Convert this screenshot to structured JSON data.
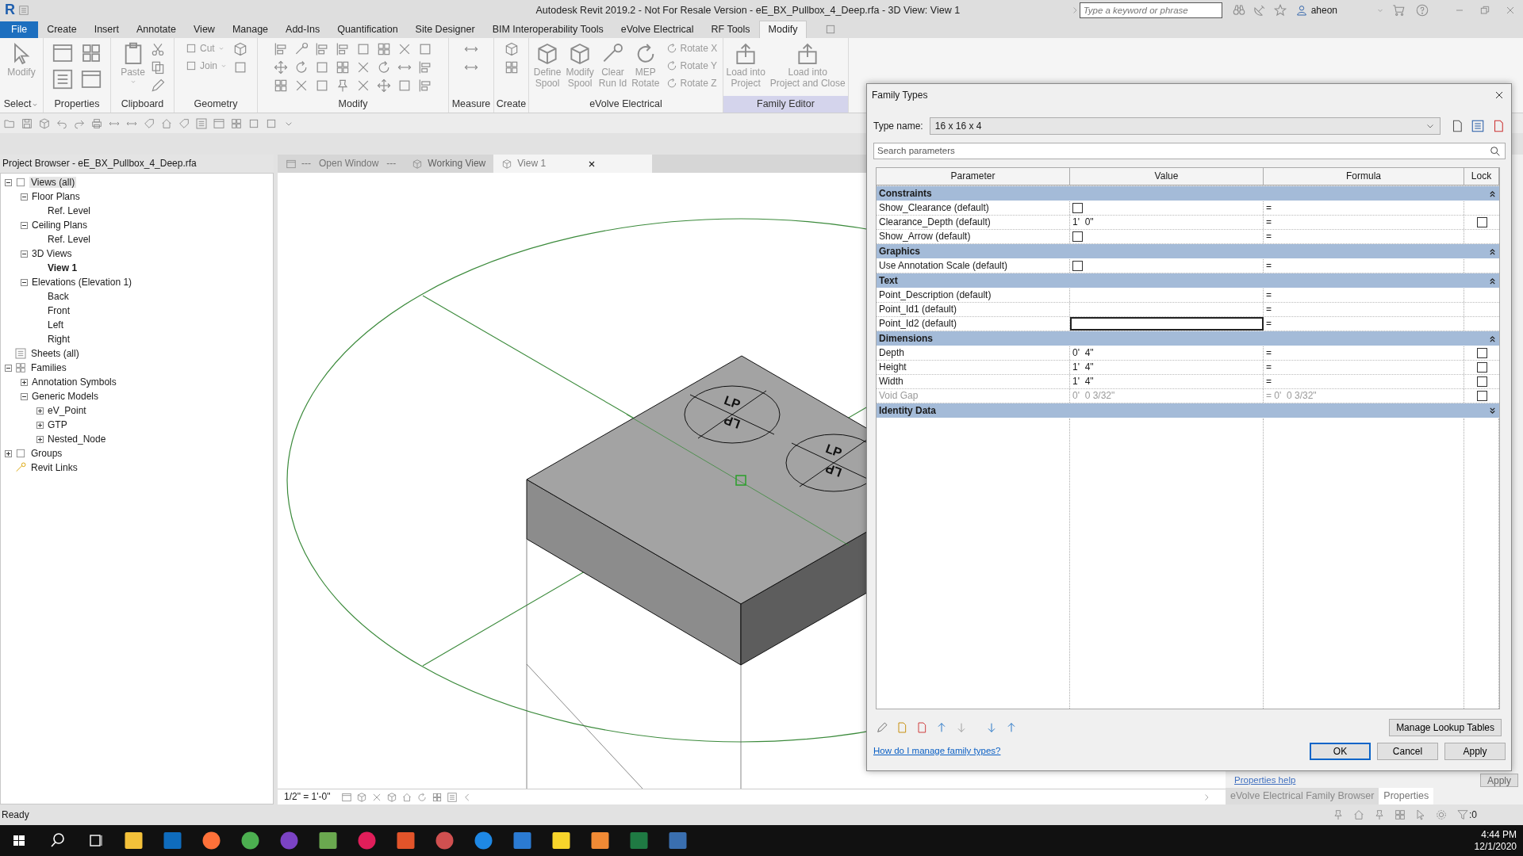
{
  "app": {
    "logo": "R",
    "title": "Autodesk Revit 2019.2 - Not For Resale Version - eE_BX_Pullbox_4_Deep.rfa - 3D View: View 1",
    "search": {
      "placeholder": "Type a keyword or phrase"
    },
    "user": "aheon"
  },
  "file_menu": "File",
  "ribbon_tabs": [
    {
      "label": "Create",
      "selected": false
    },
    {
      "label": "Insert",
      "selected": false
    },
    {
      "label": "Annotate",
      "selected": false
    },
    {
      "label": "View",
      "selected": false
    },
    {
      "label": "Manage",
      "selected": false
    },
    {
      "label": "Add-Ins",
      "selected": false
    },
    {
      "label": "Quantification",
      "selected": false
    },
    {
      "label": "Site Designer",
      "selected": false
    },
    {
      "label": "BIM Interoperability Tools",
      "selected": false
    },
    {
      "label": "eVolve Electrical",
      "selected": false
    },
    {
      "label": "RF Tools",
      "selected": false
    },
    {
      "label": "Modify",
      "selected": true
    }
  ],
  "ribbon_panels": [
    {
      "label": "Select",
      "dropdown": true,
      "contextual": false,
      "tools": [
        {
          "label": "Modify",
          "kind": "large",
          "disabled": true,
          "dropdown": false
        }
      ]
    },
    {
      "label": "Properties",
      "contextual": false
    },
    {
      "label": "Clipboard",
      "contextual": false,
      "tools": [
        {
          "label": "Paste",
          "kind": "large",
          "disabled": true,
          "dropdown": true
        }
      ]
    },
    {
      "label": "Geometry",
      "contextual": false,
      "tools": [
        {
          "label": "Cut",
          "kind": "small",
          "disabled": true,
          "dropdown": true
        },
        {
          "label": "Join",
          "kind": "small",
          "disabled": true,
          "dropdown": true
        }
      ]
    },
    {
      "label": "Modify",
      "contextual": false
    },
    {
      "label": "Measure",
      "contextual": false
    },
    {
      "label": "Create",
      "contextual": false
    },
    {
      "label": "eVolve Electrical",
      "contextual": false,
      "tools": [
        {
          "label": "Define\nSpool",
          "kind": "large",
          "disabled": true,
          "dropdown": false
        },
        {
          "label": "Modify\nSpool",
          "kind": "large",
          "disabled": true,
          "dropdown": false
        },
        {
          "label": "Clear\nRun Id",
          "kind": "large",
          "disabled": true,
          "dropdown": false
        },
        {
          "label": "MEP\nRotate",
          "kind": "large",
          "disabled": true,
          "dropdown": false
        },
        {
          "label": "Rotate X",
          "kind": "small",
          "disabled": true,
          "dropdown": false
        },
        {
          "label": "Rotate Y",
          "kind": "small",
          "disabled": true,
          "dropdown": false
        },
        {
          "label": "Rotate Z",
          "kind": "small",
          "disabled": true,
          "dropdown": false
        }
      ]
    },
    {
      "label": "Family Editor",
      "contextual": true,
      "tools": [
        {
          "label": "Load into\nProject",
          "kind": "large",
          "disabled": true,
          "dropdown": false
        },
        {
          "label": "Load into\nProject and Close",
          "kind": "large",
          "disabled": true,
          "dropdown": false
        }
      ]
    }
  ],
  "project_browser": {
    "title": "Project Browser - eE_BX_Pullbox_4_Deep.rfa",
    "tree": [
      {
        "label": "Views (all)",
        "kind": "views",
        "expanded": true,
        "selected": true,
        "active": false,
        "children": [
          {
            "label": "Floor Plans",
            "expanded": true,
            "selected": false,
            "active": false,
            "children": [
              {
                "label": "Ref. Level",
                "selected": false,
                "active": false
              }
            ]
          },
          {
            "label": "Ceiling Plans",
            "expanded": true,
            "selected": false,
            "active": false,
            "children": [
              {
                "label": "Ref. Level",
                "selected": false,
                "active": false
              }
            ]
          },
          {
            "label": "3D Views",
            "expanded": true,
            "selected": false,
            "active": false,
            "children": [
              {
                "label": "View 1",
                "selected": false,
                "active": true
              }
            ]
          },
          {
            "label": "Elevations (Elevation 1)",
            "expanded": true,
            "selected": false,
            "active": false,
            "children": [
              {
                "label": "Back",
                "selected": false,
                "active": false
              },
              {
                "label": "Front",
                "selected": false,
                "active": false
              },
              {
                "label": "Left",
                "selected": false,
                "active": false
              },
              {
                "label": "Right",
                "selected": false,
                "active": false
              }
            ]
          }
        ]
      },
      {
        "label": "Sheets (all)",
        "kind": "sheets",
        "selected": false,
        "active": false
      },
      {
        "label": "Families",
        "kind": "families",
        "expanded": true,
        "selected": false,
        "active": false,
        "children": [
          {
            "label": "Annotation Symbols",
            "expanded": false,
            "selected": false,
            "active": false
          },
          {
            "label": "Generic Models",
            "expanded": true,
            "selected": false,
            "active": false,
            "children": [
              {
                "label": "eV_Point",
                "expanded": false,
                "selected": false,
                "active": false
              },
              {
                "label": "GTP",
                "expanded": false,
                "selected": false,
                "active": false
              },
              {
                "label": "Nested_Node",
                "expanded": false,
                "selected": false,
                "active": false
              }
            ]
          }
        ]
      },
      {
        "label": "Groups",
        "kind": "groups",
        "expanded": false,
        "selected": false,
        "active": false
      },
      {
        "label": "Revit Links",
        "kind": "links",
        "selected": false,
        "active": false
      }
    ]
  },
  "view_tabs": [
    {
      "label": "---   Open Window   ---",
      "kind": "placeholder",
      "selected": false,
      "closable": false
    },
    {
      "label": "Working View",
      "kind": "view",
      "selected": false,
      "closable": false
    },
    {
      "label": "View 1",
      "kind": "view",
      "selected": true,
      "closable": true
    }
  ],
  "viewport": {
    "annotations": [
      "LP",
      "LP",
      "LP",
      "LP"
    ],
    "scale": "1/2\" = 1'-0\""
  },
  "properties_panel": {
    "help_link": "Properties help",
    "apply": "Apply",
    "tabs": [
      {
        "label": "eVolve Electrical Family Browser",
        "selected": false
      },
      {
        "label": "Properties",
        "selected": true
      }
    ]
  },
  "status_bar": {
    "text": "Ready",
    "filter_count": ":0"
  },
  "taskbar": {
    "time": "4:44 PM",
    "date": "12/1/2020"
  },
  "dialog": {
    "title": "Family Types",
    "type_name_label": "Type name:",
    "type_name": "16 x 16 x 4",
    "search": {
      "placeholder": "Search parameters"
    },
    "columns": [
      "Parameter",
      "Value",
      "Formula",
      "Lock"
    ],
    "groups": [
      {
        "name": "Constraints",
        "expanded": true,
        "params": [
          {
            "name": "Show_Clearance (default)",
            "kind": "checkbox",
            "checked": false,
            "formula": "=",
            "disabled": false,
            "editing": false
          },
          {
            "name": "Clearance_Depth (default)",
            "kind": "text",
            "value": "1'  0\"",
            "formula": "=",
            "lock": false,
            "disabled": false,
            "editing": false
          },
          {
            "name": "Show_Arrow (default)",
            "kind": "checkbox",
            "checked": false,
            "formula": "=",
            "disabled": false,
            "editing": false
          }
        ]
      },
      {
        "name": "Graphics",
        "expanded": true,
        "params": [
          {
            "name": "Use Annotation Scale (default)",
            "kind": "checkbox",
            "checked": false,
            "formula": "=",
            "disabled": false,
            "editing": false
          }
        ]
      },
      {
        "name": "Text",
        "expanded": true,
        "params": [
          {
            "name": "Point_Description (default)",
            "kind": "text",
            "formula": "=",
            "disabled": false,
            "editing": false
          },
          {
            "name": "Point_Id1 (default)",
            "kind": "text",
            "formula": "=",
            "disabled": false,
            "editing": false
          },
          {
            "name": "Point_Id2 (default)",
            "kind": "text",
            "formula": "=",
            "disabled": false,
            "editing": true
          }
        ]
      },
      {
        "name": "Dimensions",
        "expanded": true,
        "params": [
          {
            "name": "Depth",
            "kind": "text",
            "value": "0'  4\"",
            "formula": "=",
            "lock": false,
            "disabled": false,
            "editing": false
          },
          {
            "name": "Height",
            "kind": "text",
            "value": "1'  4\"",
            "formula": "=",
            "lock": false,
            "disabled": false,
            "editing": false
          },
          {
            "name": "Width",
            "kind": "text",
            "value": "1'  4\"",
            "formula": "=",
            "lock": false,
            "disabled": false,
            "editing": false
          },
          {
            "name": "Void Gap",
            "kind": "text",
            "value": "0'  0 3/32\"",
            "formula": "= 0'  0 3/32\"",
            "lock": false,
            "disabled": true,
            "editing": false
          }
        ]
      },
      {
        "name": "Identity Data",
        "expanded": false
      }
    ],
    "manage_button": "Manage Lookup Tables",
    "help_link": "How do I manage family types?",
    "buttons": [
      {
        "label": "OK",
        "default": true
      },
      {
        "label": "Cancel",
        "default": false
      },
      {
        "label": "Apply",
        "default": false
      }
    ]
  }
}
